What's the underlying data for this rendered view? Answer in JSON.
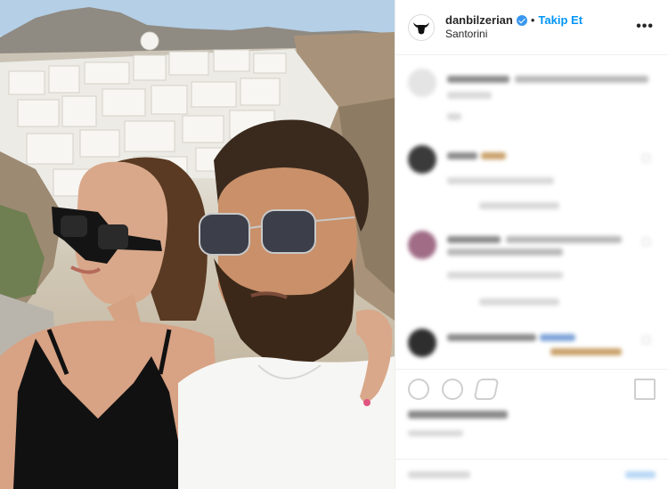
{
  "header": {
    "username": "danbilzerian",
    "separator": "•",
    "follow_label": "Takip Et",
    "location": "Santorini",
    "more_label": "•••"
  },
  "colors": {
    "accent": "#0095f6",
    "verified": "#3897f0",
    "border": "#efefef",
    "text": "#262626"
  },
  "icons": {
    "avatar": "bull-skull-icon",
    "verified": "verified-badge-icon",
    "more": "more-options-icon",
    "like": "heart-icon",
    "comment": "comment-icon",
    "share": "share-icon",
    "save": "bookmark-icon"
  }
}
